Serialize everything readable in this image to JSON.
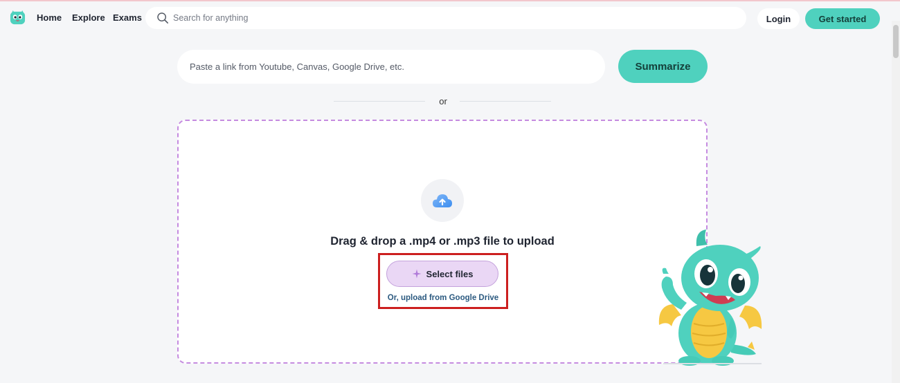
{
  "nav": {
    "home": "Home",
    "explore": "Explore",
    "exams": "Exams",
    "search_placeholder": "Search for anything",
    "login": "Login",
    "get_started": "Get started"
  },
  "main": {
    "link_placeholder": "Paste a link from Youtube, Canvas, Google Drive, etc.",
    "summarize": "Summarize",
    "or": "or",
    "drop_title": "Drag & drop a .mp4 or .mp3 file to upload",
    "select_files": "Select files",
    "google_drive": "Or, upload from Google Drive"
  },
  "icons": {
    "logo": "mascot-logo-icon",
    "search": "search-icon",
    "upload": "cloud-upload-icon",
    "sparkle": "sparkle-icon"
  },
  "colors": {
    "accent": "#4fd1be",
    "dropzone_border": "#c58be0",
    "select_bg": "#ead7f5",
    "highlight": "#cc1f1f",
    "page_bg": "#f5f6f8"
  }
}
